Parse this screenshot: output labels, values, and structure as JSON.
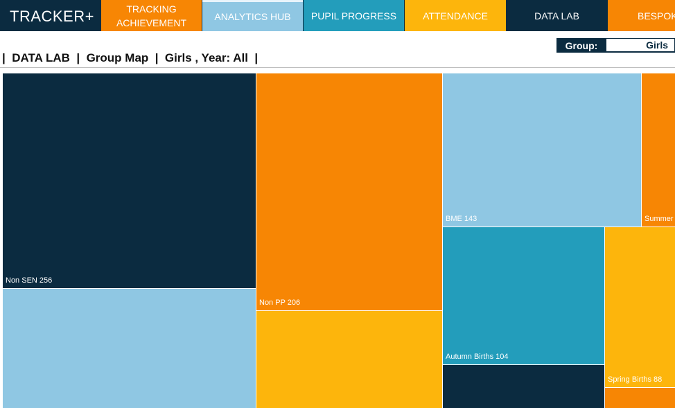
{
  "app": {
    "brand": "TRACKER+"
  },
  "nav": {
    "tracking_line1": "TRACKING",
    "tracking_line2": "ACHIEVEMENT",
    "analytics_hub": "ANALYTICS HUB",
    "pupil_progress": "PUPIL PROGRESS",
    "attendance": "ATTENDANCE",
    "data_lab": "DATA LAB",
    "bespoke": "BESPOKE"
  },
  "breadcrumb": "|  DATA LAB  |  Group Map  |  Girls , Year: All  |",
  "group_selector": {
    "label": "Group:",
    "value": "Girls"
  },
  "colors": {
    "navy": "#0b2b40",
    "orange": "#f78604",
    "light_blue": "#8fc7e3",
    "teal": "#239dbb",
    "yellow": "#fdb50c"
  },
  "treemap": {
    "tiles": [
      {
        "label": "Non SEN 256",
        "color": "#0b2b40"
      },
      {
        "label": "",
        "color": "#8fc7e3"
      },
      {
        "label": "Non PP 206",
        "color": "#f78604"
      },
      {
        "label": "",
        "color": "#fdb50c"
      },
      {
        "label": "BME 143",
        "color": "#8fc7e3"
      },
      {
        "label": "Summer",
        "color": "#f78604"
      },
      {
        "label": "Autumn Births 104",
        "color": "#239dbb"
      },
      {
        "label": "",
        "color": "#0b2b40"
      },
      {
        "label": "Spring Births 88",
        "color": "#fdb50c"
      },
      {
        "label": "",
        "color": "#f78604"
      }
    ]
  }
}
